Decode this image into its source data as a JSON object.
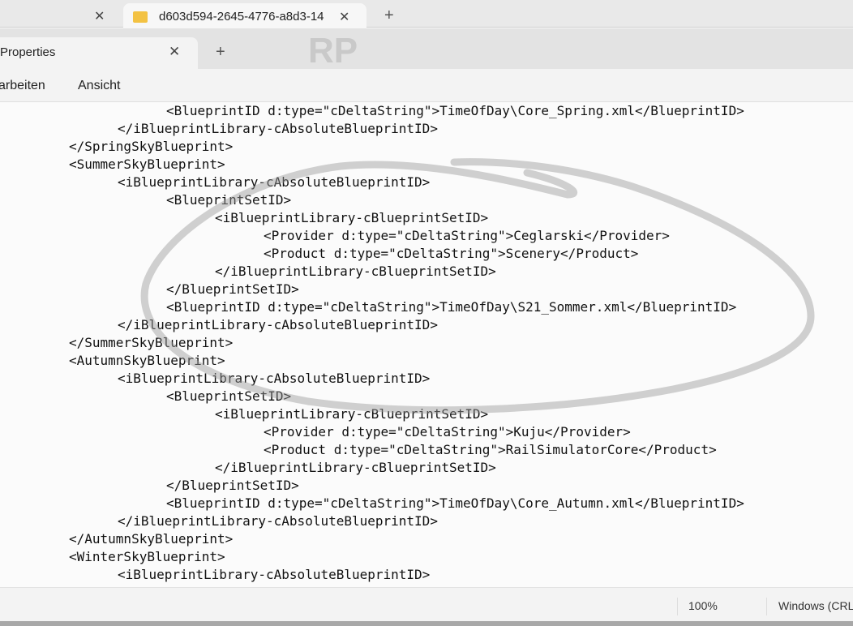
{
  "outer_tab": {
    "title": "d603d594-2645-4776-a8d3-14"
  },
  "inner_tab": {
    "title": "Properties"
  },
  "watermark": "RP",
  "menu": [
    "arbeiten",
    "Ansicht"
  ],
  "lines": [
    {
      "i": 2,
      "t": "<BlueprintID d:type=\"cDeltaString\">TimeOfDay\\Core_Spring.xml</BlueprintID>"
    },
    {
      "i": 1,
      "t": "</iBlueprintLibrary-cAbsoluteBlueprintID>"
    },
    {
      "i": 0,
      "t": "</SpringSkyBlueprint>"
    },
    {
      "i": 0,
      "t": "<SummerSkyBlueprint>"
    },
    {
      "i": 1,
      "t": "<iBlueprintLibrary-cAbsoluteBlueprintID>"
    },
    {
      "i": 2,
      "t": "<BlueprintSetID>"
    },
    {
      "i": 3,
      "t": "<iBlueprintLibrary-cBlueprintSetID>"
    },
    {
      "i": 4,
      "t": "<Provider d:type=\"cDeltaString\">Ceglarski</Provider>"
    },
    {
      "i": 4,
      "t": "<Product d:type=\"cDeltaString\">Scenery</Product>"
    },
    {
      "i": 3,
      "t": "</iBlueprintLibrary-cBlueprintSetID>"
    },
    {
      "i": 2,
      "t": "</BlueprintSetID>"
    },
    {
      "i": 2,
      "t": "<BlueprintID d:type=\"cDeltaString\">TimeOfDay\\S21_Sommer.xml</BlueprintID>"
    },
    {
      "i": 1,
      "t": "</iBlueprintLibrary-cAbsoluteBlueprintID>"
    },
    {
      "i": 0,
      "t": "</SummerSkyBlueprint>"
    },
    {
      "i": 0,
      "t": "<AutumnSkyBlueprint>"
    },
    {
      "i": 1,
      "t": "<iBlueprintLibrary-cAbsoluteBlueprintID>"
    },
    {
      "i": 2,
      "t": "<BlueprintSetID>"
    },
    {
      "i": 3,
      "t": "<iBlueprintLibrary-cBlueprintSetID>"
    },
    {
      "i": 4,
      "t": "<Provider d:type=\"cDeltaString\">Kuju</Provider>"
    },
    {
      "i": 4,
      "t": "<Product d:type=\"cDeltaString\">RailSimulatorCore</Product>"
    },
    {
      "i": 3,
      "t": "</iBlueprintLibrary-cBlueprintSetID>"
    },
    {
      "i": 2,
      "t": "</BlueprintSetID>"
    },
    {
      "i": 2,
      "t": "<BlueprintID d:type=\"cDeltaString\">TimeOfDay\\Core_Autumn.xml</BlueprintID>"
    },
    {
      "i": 1,
      "t": "</iBlueprintLibrary-cAbsoluteBlueprintID>"
    },
    {
      "i": 0,
      "t": "</AutumnSkyBlueprint>"
    },
    {
      "i": 0,
      "t": "<WinterSkyBlueprint>"
    },
    {
      "i": 1,
      "t": "<iBlueprintLibrary-cAbsoluteBlueprintID>"
    }
  ],
  "status": {
    "zoom": "100%",
    "line_ending": "Windows (CRLF)"
  }
}
